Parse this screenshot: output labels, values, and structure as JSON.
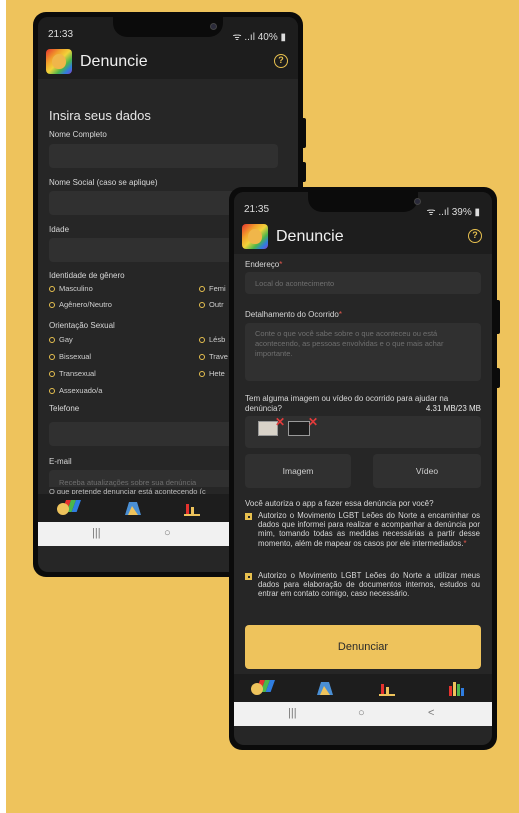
{
  "phone1": {
    "status": {
      "time": "21:33",
      "indicators": "40%"
    },
    "app_title": "Denuncie",
    "section_title": "Insira seus dados",
    "labels": {
      "nome_completo": "Nome Completo",
      "nome_social": "Nome Social (caso se aplique)",
      "idade": "Idade",
      "identidade": "Identidade de gênero",
      "orientacao": "Orientação Sexual",
      "telefone": "Telefone",
      "email": "E-mail",
      "cut_text": "O que pretende denunciar está acontecendo (c"
    },
    "gender_options": [
      "Masculino",
      "Femi",
      "Agênero/Neutro",
      "Outr"
    ],
    "orientation_options": [
      "Gay",
      "Lésb",
      "Bissexual",
      "Trave",
      "Transexual",
      "Hete",
      "Assexuado/a"
    ],
    "email_placeholder": "Receba atualizações sobre sua denúncia",
    "nav_icons": [
      "pride-flag-icon",
      "map-icon",
      "chart-icon"
    ],
    "system_nav": [
      "|||",
      "○"
    ]
  },
  "phone2": {
    "status": {
      "time": "21:35",
      "indicators": "39%"
    },
    "app_title": "Denuncie",
    "endereco_label": "Endereço",
    "endereco_placeholder": "Local do acontecimento",
    "detalhe_label": "Detalhamento do Ocorrido",
    "detalhe_placeholder": "Conte o que você sabe sobre o que aconteceu ou está acontecendo, as pessoas envolvidas e o que mais achar importante.",
    "required_mark": "*",
    "media_question": "Tem alguma imagem ou vídeo do ocorrido para ajudar na denúncia?",
    "media_size": "4.31 MB/23 MB",
    "btn_imagem": "Imagem",
    "btn_video": "Vídeo",
    "consent_question": "Você autoriza o app a fazer essa denúncia por você?",
    "consent1": "Autorizo o Movimento LGBT Leões do Norte a encaminhar os dados que informei para realizar e acompanhar a denúncia por mim, tomando todas as medidas necessárias a partir desse momento, além de mapear os casos por ele intermediados.",
    "consent2": "Autorizo o Movimento LGBT Leões do Norte a utilizar meus dados para elaboração de documentos internos, estudos ou entrar em contato comigo, caso necessário.",
    "submit": "Denunciar",
    "nav_icons": [
      "pride-flag-icon",
      "map-icon",
      "chart-icon",
      "stats-icon"
    ],
    "system_nav": [
      "|||",
      "○",
      "<"
    ]
  },
  "colors": {
    "accent": "#eec35c",
    "background": "#262626",
    "field": "#303030",
    "required": "#e2574c"
  }
}
